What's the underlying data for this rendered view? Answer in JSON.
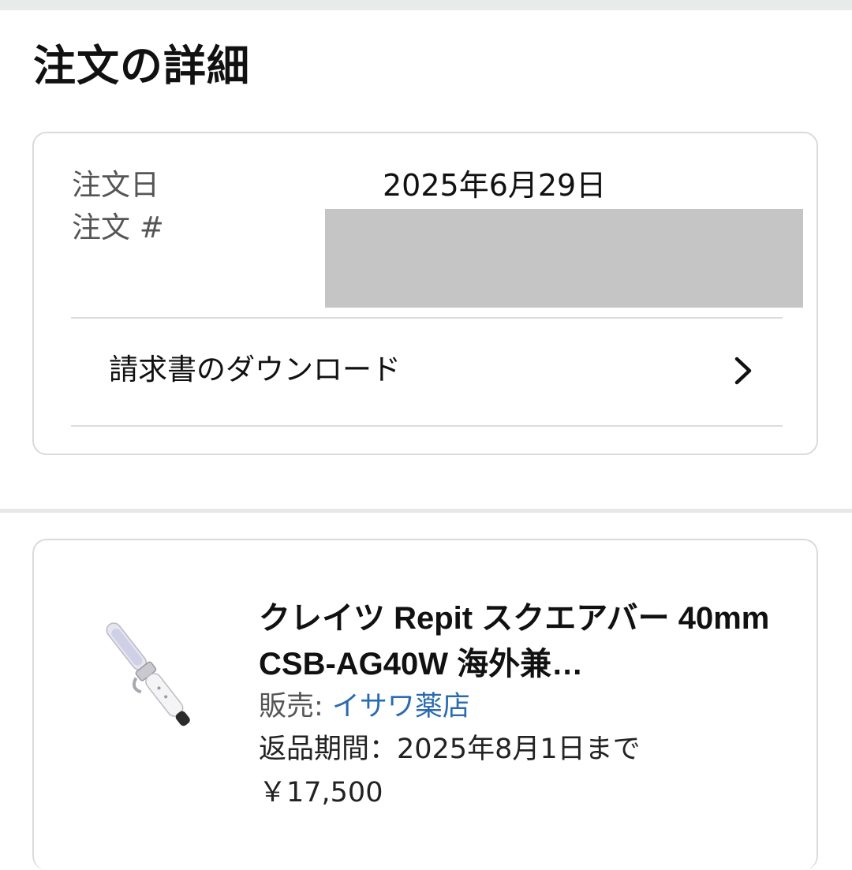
{
  "page": {
    "title": "注文の詳細"
  },
  "order": {
    "date_label": "注文日",
    "date_value": "2025年6月29日",
    "number_label": "注文 #",
    "invoice_label": "請求書のダウンロード"
  },
  "item": {
    "title": "クレイツ Repit スクエアバー 40mm CSB-AG40W 海外兼…",
    "seller_prefix": "販売: ",
    "seller_name": "イサワ薬店",
    "return_text": "返品期間：2025年8月1日まで",
    "price": "￥17,500"
  },
  "colors": {
    "link": "#2a6bb0",
    "border": "#d9dbdb",
    "redaction": "#c5c5c5"
  },
  "icons": [
    "chevron-right-icon"
  ]
}
